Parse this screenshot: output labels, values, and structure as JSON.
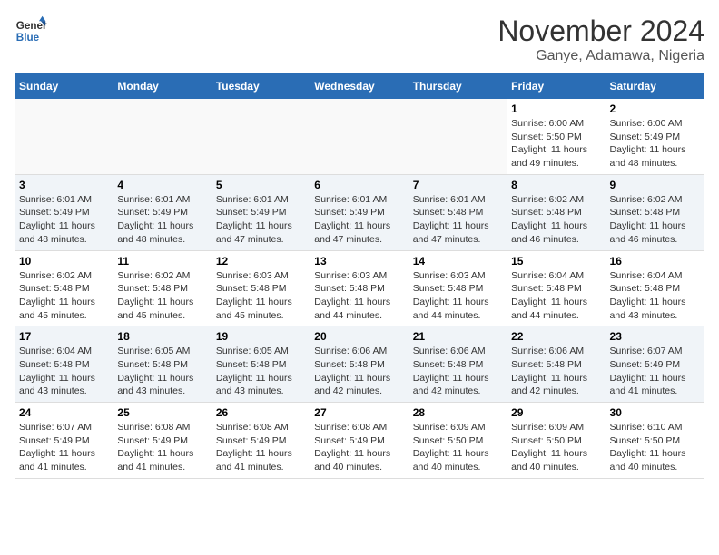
{
  "logo": {
    "line1": "General",
    "line2": "Blue"
  },
  "title": "November 2024",
  "location": "Ganye, Adamawa, Nigeria",
  "weekdays": [
    "Sunday",
    "Monday",
    "Tuesday",
    "Wednesday",
    "Thursday",
    "Friday",
    "Saturday"
  ],
  "weeks": [
    [
      {
        "day": "",
        "info": ""
      },
      {
        "day": "",
        "info": ""
      },
      {
        "day": "",
        "info": ""
      },
      {
        "day": "",
        "info": ""
      },
      {
        "day": "",
        "info": ""
      },
      {
        "day": "1",
        "info": "Sunrise: 6:00 AM\nSunset: 5:50 PM\nDaylight: 11 hours and 49 minutes."
      },
      {
        "day": "2",
        "info": "Sunrise: 6:00 AM\nSunset: 5:49 PM\nDaylight: 11 hours and 48 minutes."
      }
    ],
    [
      {
        "day": "3",
        "info": "Sunrise: 6:01 AM\nSunset: 5:49 PM\nDaylight: 11 hours and 48 minutes."
      },
      {
        "day": "4",
        "info": "Sunrise: 6:01 AM\nSunset: 5:49 PM\nDaylight: 11 hours and 48 minutes."
      },
      {
        "day": "5",
        "info": "Sunrise: 6:01 AM\nSunset: 5:49 PM\nDaylight: 11 hours and 47 minutes."
      },
      {
        "day": "6",
        "info": "Sunrise: 6:01 AM\nSunset: 5:49 PM\nDaylight: 11 hours and 47 minutes."
      },
      {
        "day": "7",
        "info": "Sunrise: 6:01 AM\nSunset: 5:48 PM\nDaylight: 11 hours and 47 minutes."
      },
      {
        "day": "8",
        "info": "Sunrise: 6:02 AM\nSunset: 5:48 PM\nDaylight: 11 hours and 46 minutes."
      },
      {
        "day": "9",
        "info": "Sunrise: 6:02 AM\nSunset: 5:48 PM\nDaylight: 11 hours and 46 minutes."
      }
    ],
    [
      {
        "day": "10",
        "info": "Sunrise: 6:02 AM\nSunset: 5:48 PM\nDaylight: 11 hours and 45 minutes."
      },
      {
        "day": "11",
        "info": "Sunrise: 6:02 AM\nSunset: 5:48 PM\nDaylight: 11 hours and 45 minutes."
      },
      {
        "day": "12",
        "info": "Sunrise: 6:03 AM\nSunset: 5:48 PM\nDaylight: 11 hours and 45 minutes."
      },
      {
        "day": "13",
        "info": "Sunrise: 6:03 AM\nSunset: 5:48 PM\nDaylight: 11 hours and 44 minutes."
      },
      {
        "day": "14",
        "info": "Sunrise: 6:03 AM\nSunset: 5:48 PM\nDaylight: 11 hours and 44 minutes."
      },
      {
        "day": "15",
        "info": "Sunrise: 6:04 AM\nSunset: 5:48 PM\nDaylight: 11 hours and 44 minutes."
      },
      {
        "day": "16",
        "info": "Sunrise: 6:04 AM\nSunset: 5:48 PM\nDaylight: 11 hours and 43 minutes."
      }
    ],
    [
      {
        "day": "17",
        "info": "Sunrise: 6:04 AM\nSunset: 5:48 PM\nDaylight: 11 hours and 43 minutes."
      },
      {
        "day": "18",
        "info": "Sunrise: 6:05 AM\nSunset: 5:48 PM\nDaylight: 11 hours and 43 minutes."
      },
      {
        "day": "19",
        "info": "Sunrise: 6:05 AM\nSunset: 5:48 PM\nDaylight: 11 hours and 43 minutes."
      },
      {
        "day": "20",
        "info": "Sunrise: 6:06 AM\nSunset: 5:48 PM\nDaylight: 11 hours and 42 minutes."
      },
      {
        "day": "21",
        "info": "Sunrise: 6:06 AM\nSunset: 5:48 PM\nDaylight: 11 hours and 42 minutes."
      },
      {
        "day": "22",
        "info": "Sunrise: 6:06 AM\nSunset: 5:48 PM\nDaylight: 11 hours and 42 minutes."
      },
      {
        "day": "23",
        "info": "Sunrise: 6:07 AM\nSunset: 5:49 PM\nDaylight: 11 hours and 41 minutes."
      }
    ],
    [
      {
        "day": "24",
        "info": "Sunrise: 6:07 AM\nSunset: 5:49 PM\nDaylight: 11 hours and 41 minutes."
      },
      {
        "day": "25",
        "info": "Sunrise: 6:08 AM\nSunset: 5:49 PM\nDaylight: 11 hours and 41 minutes."
      },
      {
        "day": "26",
        "info": "Sunrise: 6:08 AM\nSunset: 5:49 PM\nDaylight: 11 hours and 41 minutes."
      },
      {
        "day": "27",
        "info": "Sunrise: 6:08 AM\nSunset: 5:49 PM\nDaylight: 11 hours and 40 minutes."
      },
      {
        "day": "28",
        "info": "Sunrise: 6:09 AM\nSunset: 5:50 PM\nDaylight: 11 hours and 40 minutes."
      },
      {
        "day": "29",
        "info": "Sunrise: 6:09 AM\nSunset: 5:50 PM\nDaylight: 11 hours and 40 minutes."
      },
      {
        "day": "30",
        "info": "Sunrise: 6:10 AM\nSunset: 5:50 PM\nDaylight: 11 hours and 40 minutes."
      }
    ]
  ]
}
